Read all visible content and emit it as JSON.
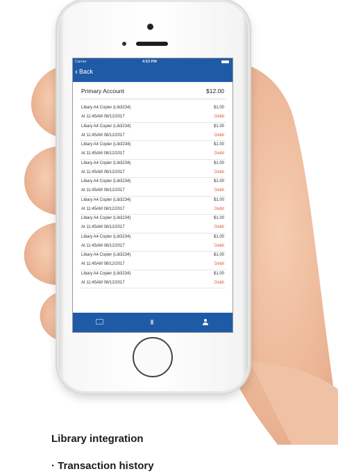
{
  "app": {
    "status_bar": {
      "carrier": "Carrier",
      "time": "4:53 PM"
    },
    "navbar": {
      "back_label": "Back"
    },
    "account": {
      "name": "Primary Account",
      "balance": "$12.00"
    },
    "transactions": [
      {
        "description": "Libary A4 Copier (Lib3234)",
        "amount": "$1.00",
        "timestamp": "At 11:45AM 08/12/2017",
        "type": "Debit"
      },
      {
        "description": "Libary A4 Copier (Lib3234)",
        "amount": "$1.00",
        "timestamp": "At 11:45AM 08/12/2017",
        "type": "Debit"
      },
      {
        "description": "Libary A4 Copier (Lib3234)",
        "amount": "$1.00",
        "timestamp": "At 11:45AM 08/12/2017",
        "type": "Debit"
      },
      {
        "description": "Libary A4 Copier (Lib3234)",
        "amount": "$1.00",
        "timestamp": "At 11:45AM 08/12/2017",
        "type": "Debit"
      },
      {
        "description": "Libary A4 Copier (Lib3234)",
        "amount": "$1.00",
        "timestamp": "At 11:45AM 08/12/2017",
        "type": "Debit"
      },
      {
        "description": "Libary A4 Copier (Lib3234)",
        "amount": "$1.00",
        "timestamp": "At 11:45AM 08/12/2017",
        "type": "Debit"
      },
      {
        "description": "Libary A4 Copier (Lib3234)",
        "amount": "$1.00",
        "timestamp": "At 11:45AM 08/12/2017",
        "type": "Debit"
      },
      {
        "description": "Libary A4 Copier (Lib3234)",
        "amount": "$1.00",
        "timestamp": "At 11:45AM 08/12/2017",
        "type": "Debit"
      },
      {
        "description": "Libary A4 Copier (Lib3234)",
        "amount": "$1.00",
        "timestamp": "At 11:45AM 08/12/2017",
        "type": "Debit"
      },
      {
        "description": "Libary A4 Copier (Lib3234)",
        "amount": "$1.00",
        "timestamp": "At 11:45AM 08/12/2017",
        "type": "Debit"
      }
    ],
    "tabbar": {
      "tabs": [
        "wallet-icon",
        "card-icon",
        "user-icon"
      ],
      "active_tab": "user-icon"
    },
    "colors": {
      "primary": "#1f5aa6",
      "debit": "#e0533b"
    }
  },
  "captions": {
    "line1": "Library integration",
    "line2": "· Transaction history"
  }
}
